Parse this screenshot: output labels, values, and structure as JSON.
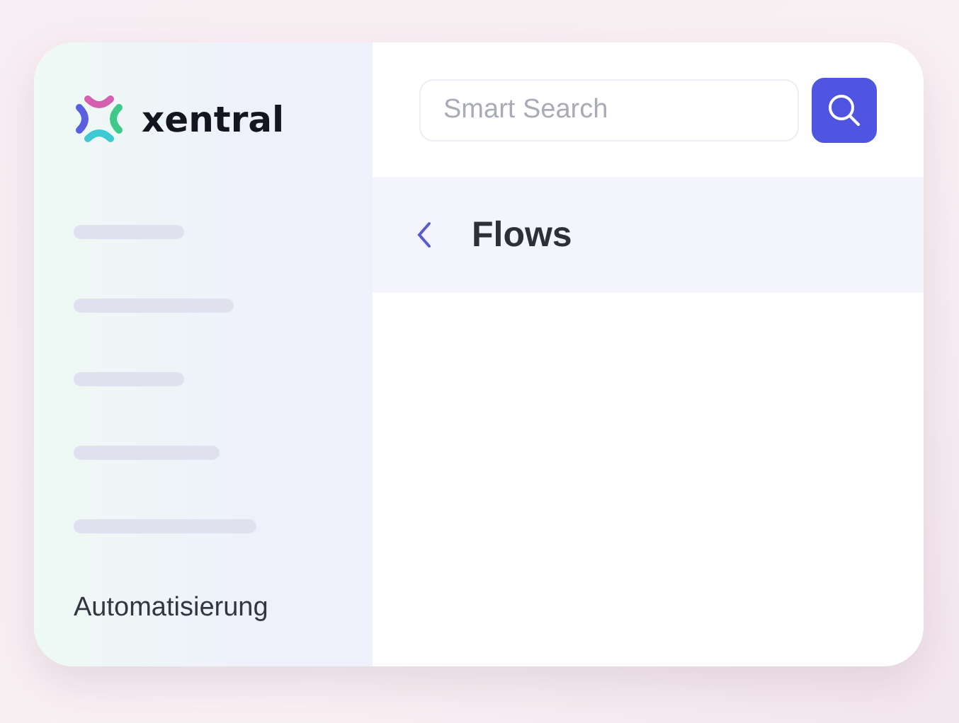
{
  "brand": {
    "name": "xentral"
  },
  "sidebar": {
    "section": "Automatisierung"
  },
  "search": {
    "placeholder": "Smart Search"
  },
  "page": {
    "title": "Flows"
  }
}
